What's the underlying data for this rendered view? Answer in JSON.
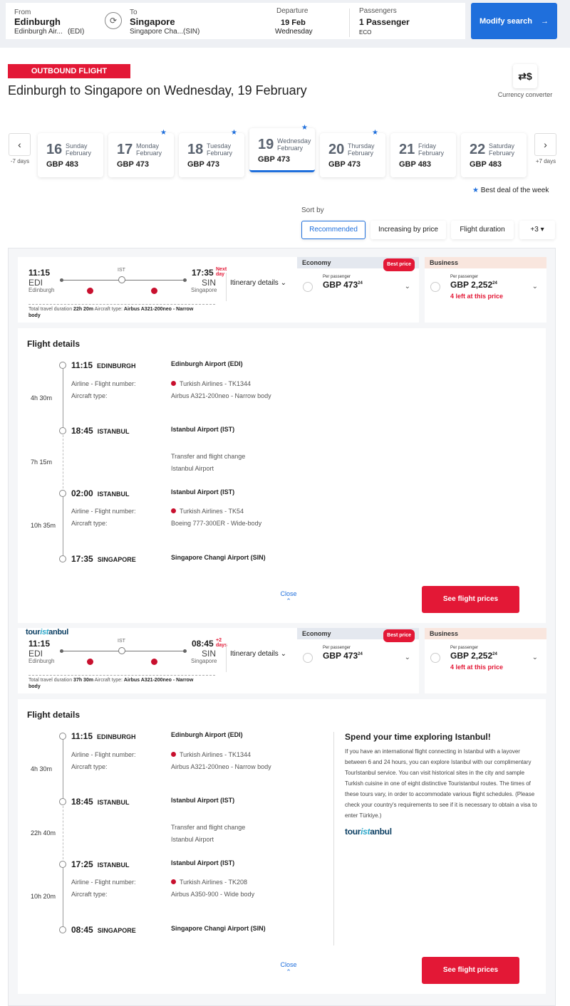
{
  "search": {
    "from_label": "From",
    "from_city": "Edinburgh",
    "from_airport": "Edinburgh Air...",
    "from_code": "(EDI)",
    "to_label": "To",
    "to_city": "Singapore",
    "to_airport": "Singapore Cha...",
    "to_code": "(SIN)",
    "departure_label": "Departure",
    "departure_date": "19 Feb",
    "departure_day": "Wednesday",
    "passengers_label": "Passengers",
    "passengers_value": "1 Passenger",
    "cabin": "ECO",
    "modify_label": "Modify search",
    "swap_icon": "swap-icon"
  },
  "header": {
    "badge": "OUTBOUND FLIGHT",
    "title": "Edinburgh to Singapore on Wednesday, 19 February",
    "currency_label": "Currency converter"
  },
  "dates": {
    "prev_label": "-7 days",
    "next_label": "+7 days",
    "days": [
      {
        "num": "16",
        "weekday": "Sunday",
        "month": "February",
        "price": "GBP 483",
        "best": false,
        "selected": false
      },
      {
        "num": "17",
        "weekday": "Monday",
        "month": "February",
        "price": "GBP 473",
        "best": true,
        "selected": false
      },
      {
        "num": "18",
        "weekday": "Tuesday",
        "month": "February",
        "price": "GBP 473",
        "best": true,
        "selected": false
      },
      {
        "num": "19",
        "weekday": "Wednesday",
        "month": "February",
        "price": "GBP 473",
        "best": true,
        "selected": true
      },
      {
        "num": "20",
        "weekday": "Thursday",
        "month": "February",
        "price": "GBP 473",
        "best": true,
        "selected": false
      },
      {
        "num": "21",
        "weekday": "Friday",
        "month": "February",
        "price": "GBP 483",
        "best": false,
        "selected": false
      },
      {
        "num": "22",
        "weekday": "Saturday",
        "month": "February",
        "price": "GBP 483",
        "best": false,
        "selected": false
      }
    ],
    "best_deal_label": "Best deal of the week"
  },
  "sort": {
    "label": "Sort by",
    "options": [
      "Recommended",
      "Increasing by price",
      "Flight duration",
      "+3"
    ],
    "active": "Recommended"
  },
  "colors": {
    "accent": "#1f6fdc",
    "brand_red": "#e31836"
  },
  "flights": [
    {
      "dep_time": "11:15",
      "dep_code": "EDI",
      "dep_city": "Edinburgh",
      "stop": "IST",
      "arr_time": "17:35",
      "arr_code": "SIN",
      "arr_city": "Singapore",
      "arr_note_1": "Next",
      "arr_note_2": "day",
      "total_label": "Total travel duration",
      "total": "22h 20m",
      "aircraft_label": "Aircraft type:",
      "aircraft": "Airbus A321-200neo - Narrow",
      "aircraft_2": "body",
      "itinerary_label": "Itinerary details",
      "economy": {
        "label": "Economy",
        "badge": "Best price",
        "per": "Per passenger",
        "price": "GBP 473",
        "cents": "24"
      },
      "business": {
        "label": "Business",
        "per": "Per passenger",
        "price": "GBP 2,252",
        "cents": "24",
        "left": "4 left at this price"
      },
      "details": {
        "title": "Flight details",
        "segments": [
          {
            "time": "11:15",
            "city": "EDINBURGH",
            "airport": "Edinburgh Airport (EDI)"
          },
          {
            "airline_label": "Airline - Flight number:",
            "airline": "Turkish Airlines - TK1344",
            "aircraft_label": "Aircraft type:",
            "aircraft": "Airbus A321-200neo - Narrow body",
            "duration": "4h 30m"
          },
          {
            "time": "18:45",
            "city": "ISTANBUL",
            "airport": "Istanbul Airport (IST)"
          },
          {
            "transfer": "Transfer and flight change",
            "transfer_place": "Istanbul Airport",
            "duration": "7h 15m"
          },
          {
            "time": "02:00",
            "city": "ISTANBUL",
            "airport": "Istanbul Airport (IST)"
          },
          {
            "airline_label": "Airline - Flight number:",
            "airline": "Turkish Airlines - TK54",
            "aircraft_label": "Aircraft type:",
            "aircraft": "Boeing 777-300ER - Wide-body",
            "duration": "10h 35m"
          },
          {
            "time": "17:35",
            "city": "SINGAPORE",
            "airport": "Singapore Changi Airport (SIN)"
          }
        ],
        "close_label": "Close",
        "see_prices": "See flight prices"
      }
    },
    {
      "logo_a": "tour",
      "logo_b": "ist",
      "logo_c": "anbul",
      "dep_time": "11:15",
      "dep_code": "EDI",
      "dep_city": "Edinburgh",
      "stop": "IST",
      "arr_time": "08:45",
      "arr_code": "SIN",
      "arr_city": "Singapore",
      "arr_note_1": "+2",
      "arr_note_2": "days",
      "total_label": "Total travel duration",
      "total": "37h 30m",
      "aircraft_label": "Aircraft type:",
      "aircraft": "Airbus A321-200neo - Narrow",
      "aircraft_2": "body",
      "itinerary_label": "Itinerary details",
      "economy": {
        "label": "Economy",
        "badge": "Best price",
        "per": "Per passenger",
        "price": "GBP 473",
        "cents": "24"
      },
      "business": {
        "label": "Business",
        "per": "Per passenger",
        "price": "GBP 2,252",
        "cents": "24",
        "left": "4 left at this price"
      },
      "details": {
        "title": "Flight details",
        "segments": [
          {
            "time": "11:15",
            "city": "EDINBURGH",
            "airport": "Edinburgh Airport (EDI)"
          },
          {
            "airline_label": "Airline - Flight number:",
            "airline": "Turkish Airlines - TK1344",
            "aircraft_label": "Aircraft type:",
            "aircraft": "Airbus A321-200neo - Narrow body",
            "duration": "4h 30m"
          },
          {
            "time": "18:45",
            "city": "ISTANBUL",
            "airport": "Istanbul Airport (IST)"
          },
          {
            "transfer": "Transfer and flight change",
            "transfer_place": "Istanbul Airport",
            "duration": "22h 40m"
          },
          {
            "time": "17:25",
            "city": "ISTANBUL",
            "airport": "Istanbul Airport (IST)"
          },
          {
            "airline_label": "Airline - Flight number:",
            "airline": "Turkish Airlines - TK208",
            "aircraft_label": "Aircraft type:",
            "aircraft": "Airbus A350-900 - Wide body",
            "duration": "10h 20m"
          },
          {
            "time": "08:45",
            "city": "SINGAPORE",
            "airport": "Singapore Changi Airport (SIN)"
          }
        ],
        "promo_title": "Spend your time exploring Istanbul!",
        "promo_text": "If you have an international flight connecting in Istanbul with a layover between 6 and 24 hours, you can explore Istanbul with our complimentary TourIstanbul service. You can visit historical sites in the city and sample Turkish cuisine in one of eight distinctive Touristanbul routes. The times of these tours vary, in order to accommodate various flight schedules. (Please check your country's requirements to see if it is necessary to obtain a visa to enter Türkiye.)",
        "close_label": "Close",
        "see_prices": "See flight prices"
      }
    }
  ]
}
